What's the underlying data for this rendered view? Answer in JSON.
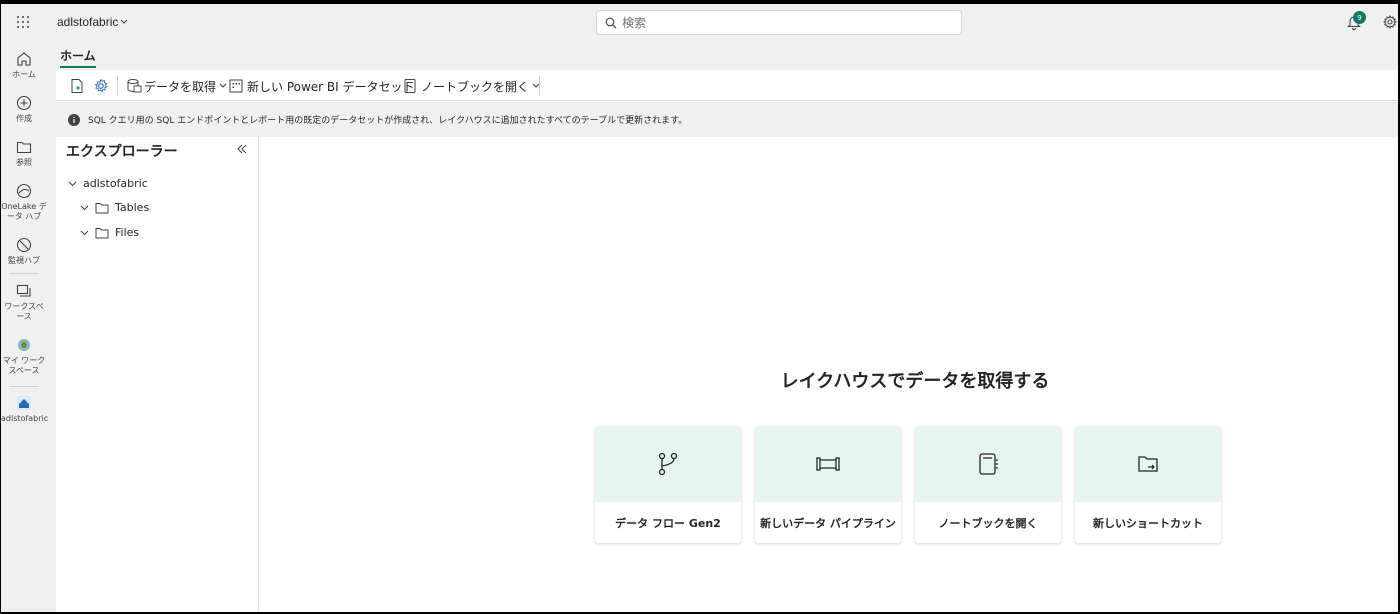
{
  "topbar": {
    "workspace_name": "adlstofabric",
    "search_placeholder": "検索",
    "notification_count": "9"
  },
  "rail": {
    "items": [
      {
        "label": "ホーム",
        "icon": "home-icon"
      },
      {
        "label": "作成",
        "icon": "plus-circle-icon"
      },
      {
        "label": "参照",
        "icon": "folder-icon"
      },
      {
        "label": "OneLake データ ハブ",
        "icon": "onelake-icon"
      },
      {
        "label": "監視ハブ",
        "icon": "monitor-icon"
      },
      {
        "label": "ワークスペース",
        "icon": "workspaces-icon"
      },
      {
        "label": "マイ ワークスペース",
        "icon": "my-workspace-icon"
      },
      {
        "label": "adlstofabric",
        "icon": "lakehouse-icon"
      }
    ]
  },
  "ribbon": {
    "home_tab": "ホーム",
    "get_data": "データを取得",
    "new_dataset": "新しい Power BI データセット",
    "open_notebook": "ノートブックを開く"
  },
  "info": {
    "message": "SQL クエリ用の SQL エンドポイントとレポート用の既定のデータセットが作成され、レイクハウスに追加されたすべてのテーブルで更新されます。"
  },
  "explorer": {
    "title": "エクスプローラー",
    "root": "adlstofabric",
    "folders": [
      "Tables",
      "Files"
    ]
  },
  "main": {
    "title": "レイクハウスでデータを取得する",
    "cards": [
      {
        "label": "データ フロー Gen2",
        "icon": "dataflow-icon"
      },
      {
        "label": "新しいデータ パイプライン",
        "icon": "pipeline-icon"
      },
      {
        "label": "ノートブックを開く",
        "icon": "notebook-icon"
      },
      {
        "label": "新しいショートカット",
        "icon": "shortcut-icon"
      }
    ]
  },
  "colors": {
    "accent": "#117865",
    "card_top": "#e6f5f0",
    "chrome_bg": "#f0f0f0"
  }
}
